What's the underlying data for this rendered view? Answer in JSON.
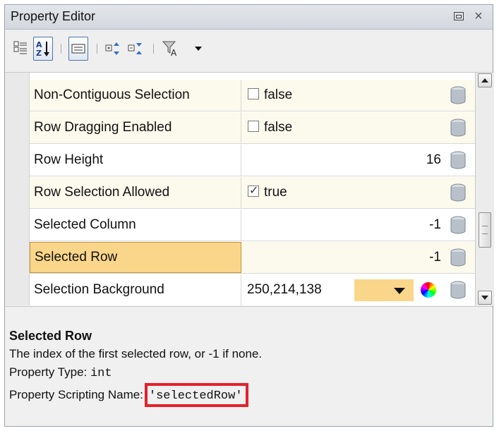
{
  "window": {
    "title": "Property Editor"
  },
  "toolbar": {
    "buttons": [
      {
        "icon": "categorized-view-icon"
      },
      {
        "icon": "sort-alphabetical-icon"
      },
      {
        "icon": "description-panel-icon"
      },
      {
        "icon": "expand-all-icon"
      },
      {
        "icon": "collapse-all-icon"
      },
      {
        "icon": "filter-icon"
      },
      {
        "icon": "dropdown-arrow-icon"
      }
    ]
  },
  "properties": [
    {
      "name": "Non-Contiguous Selection",
      "type": "checkbox",
      "checked": false,
      "value": "false"
    },
    {
      "name": "Row Dragging Enabled",
      "type": "checkbox",
      "checked": false,
      "value": "false"
    },
    {
      "name": "Row Height",
      "type": "number",
      "value": "16"
    },
    {
      "name": "Row Selection Allowed",
      "type": "checkbox",
      "checked": true,
      "value": "true"
    },
    {
      "name": "Selected Column",
      "type": "number",
      "value": "-1"
    },
    {
      "name": "Selected Row",
      "type": "number",
      "value": "-1",
      "selected": true
    },
    {
      "name": "Selection Background",
      "type": "color",
      "value": "250,214,138",
      "color": "#fad68a"
    }
  ],
  "description": {
    "title": "Selected Row",
    "text": "The index of the first selected row, or -1 if none.",
    "type_label": "Property Type:",
    "type_value": "int",
    "scripting_label": "Property Scripting Name:",
    "scripting_value": "'selectedRow'"
  },
  "colors": {
    "selection": "#fad68a",
    "highlight_box": "#e3222b",
    "alt_row": "#fcfaec"
  }
}
